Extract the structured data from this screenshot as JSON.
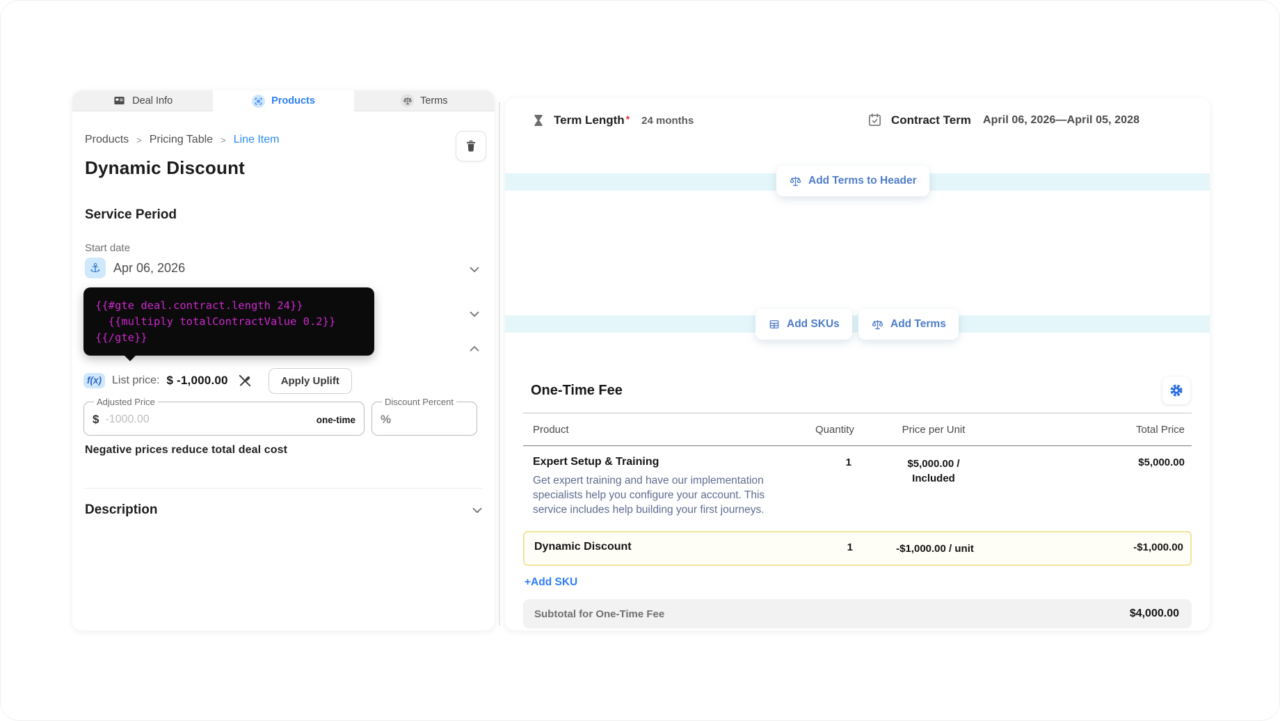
{
  "colors": {
    "accent_blue": "#2f7ef7",
    "button_blue": "#4d7cc9",
    "band_cyan": "#e4f6fa",
    "code_magenta": "#cb28cb",
    "highlight_yellow": "#f2e49e",
    "icon_badge_blue": "#cfe8fc",
    "required_red": "#e03131"
  },
  "left_panel": {
    "tabs": [
      {
        "label": "Deal Info"
      },
      {
        "label": "Products"
      },
      {
        "label": "Terms"
      }
    ],
    "breadcrumb": {
      "items": [
        "Products",
        "Pricing Table",
        "Line Item"
      ],
      "separator": ">"
    },
    "title": "Dynamic Discount",
    "service_period": {
      "heading": "Service Period",
      "start_date_label": "Start date",
      "start_date_value": "Apr 06, 2026",
      "formula_lines": [
        "{{#gte deal.contract.length 24}}",
        "  {{multiply totalContractValue 0.2}}",
        "{{/gte}}"
      ],
      "fx_badge": "f(x)",
      "list_price_label": "List price:",
      "list_price_value": "$ -1,000.00",
      "apply_uplift_label": "Apply Uplift",
      "adjusted_price_legend": "Adjusted Price",
      "currency_symbol": "$",
      "adjusted_price_placeholder": "-1000.00",
      "billing_period": "one-time",
      "discount_percent_legend": "Discount Percent",
      "percent_symbol": "%",
      "helper_text": "Negative prices reduce total deal cost"
    },
    "description_heading": "Description"
  },
  "right_panel": {
    "term_length_label": "Term Length",
    "required_marker": "*",
    "term_length_value": "24 months",
    "contract_term_label": "Contract Term",
    "contract_term_value": "April 06, 2026—April 05, 2028",
    "add_terms_to_header_label": "Add Terms to Header",
    "add_skus_label": "Add SKUs",
    "add_terms_label": "Add Terms",
    "fee_section": {
      "title": "One-Time Fee",
      "columns": [
        "Product",
        "Quantity",
        "Price per Unit",
        "Total Price"
      ],
      "rows": [
        {
          "name": "Expert Setup & Training",
          "description": "Get expert training and have our implementation specialists help you configure your account. This service includes help building your first journeys.",
          "quantity": "1",
          "price_per_unit_line1": "$5,000.00 /",
          "price_per_unit_line2": "Included",
          "total": "$5,000.00"
        },
        {
          "name": "Dynamic Discount",
          "quantity": "1",
          "price_per_unit_line1": "-$1,000.00 / unit",
          "total": "-$1,000.00"
        }
      ],
      "add_sku_label": "+Add SKU",
      "subtotal_label": "Subtotal for One-Time Fee",
      "subtotal_value": "$4,000.00"
    }
  }
}
